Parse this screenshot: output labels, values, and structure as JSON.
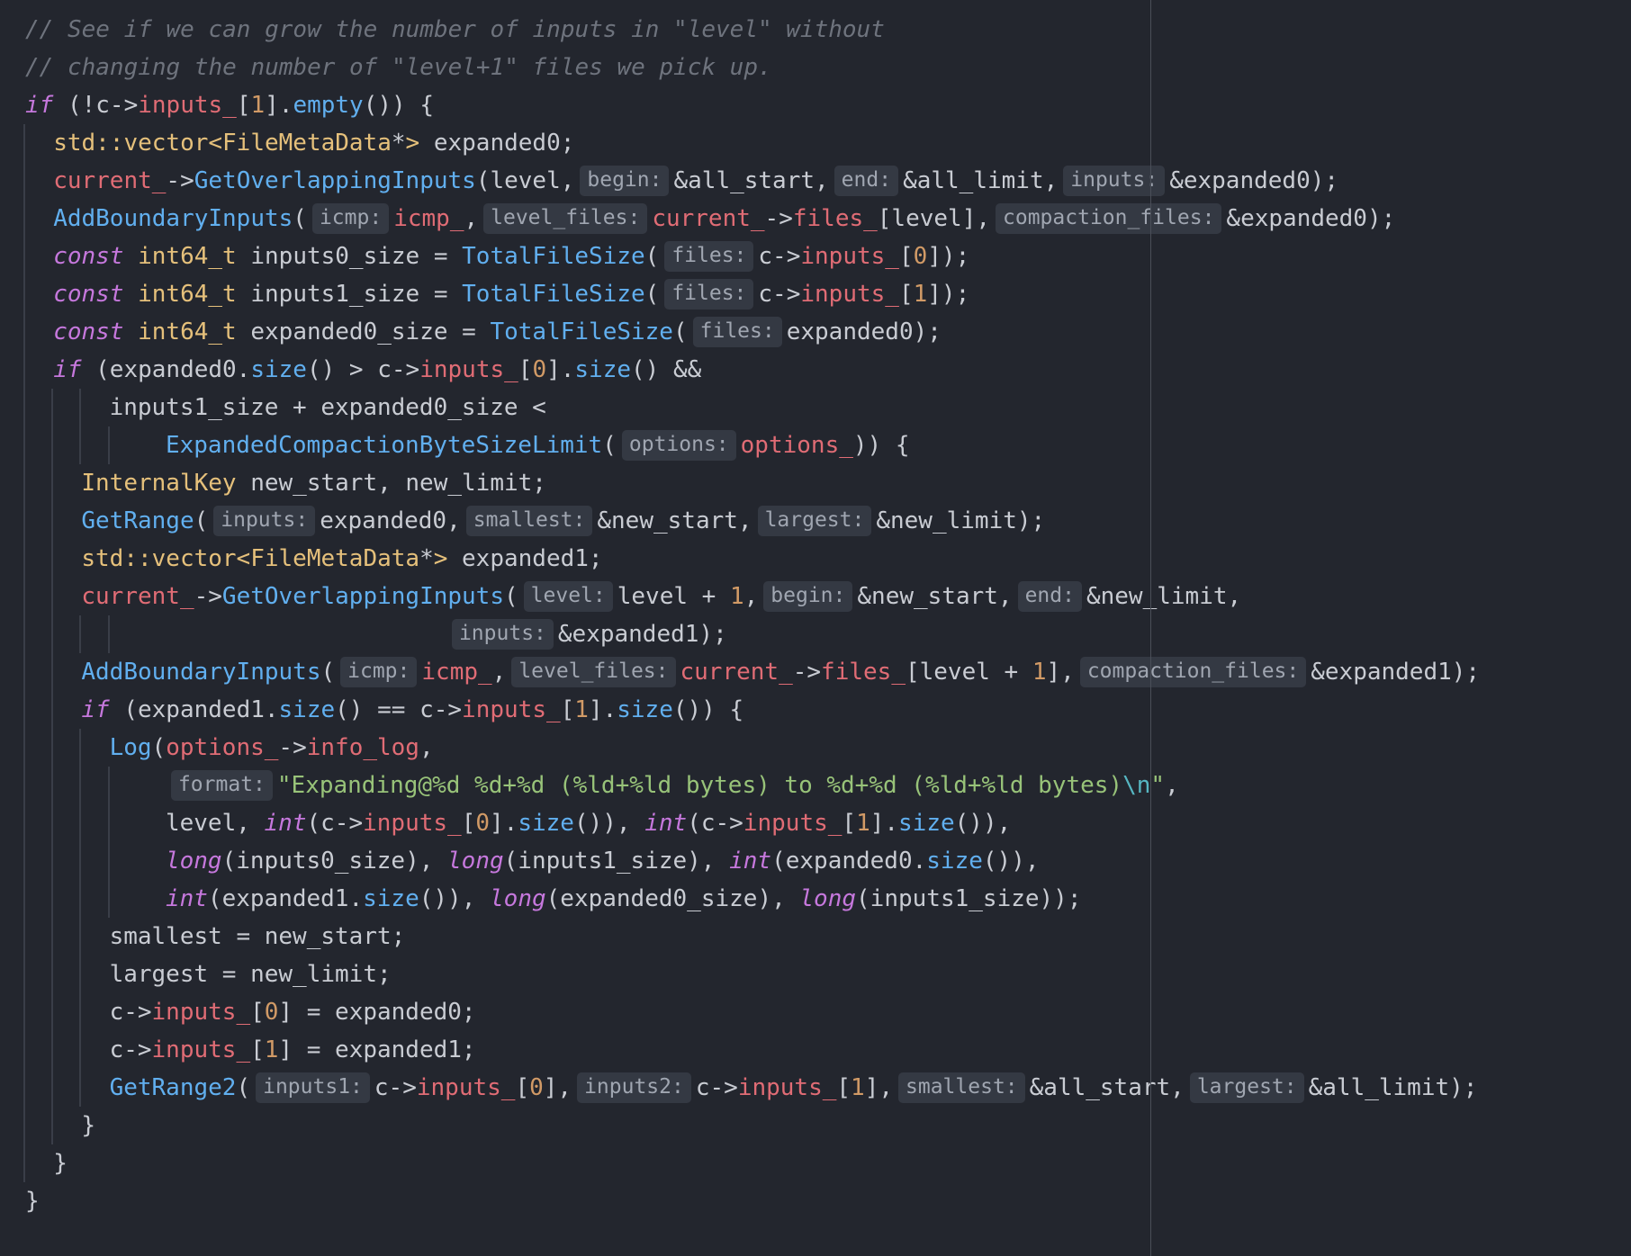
{
  "editor": {
    "language": "C++",
    "lines": [
      {
        "indent": 0,
        "guides": 0,
        "t": [
          {
            "c": "cm",
            "v": "// See if we can grow the number of inputs in \"level\" without"
          }
        ]
      },
      {
        "indent": 0,
        "guides": 0,
        "t": [
          {
            "c": "cm",
            "v": "// changing the number of \"level+1\" files we pick up."
          }
        ]
      },
      {
        "indent": 0,
        "guides": 0,
        "t": [
          {
            "c": "kw",
            "v": "if"
          },
          {
            "c": "",
            "v": " (!c->"
          },
          {
            "c": "fd",
            "v": "inputs_"
          },
          {
            "c": "",
            "v": "["
          },
          {
            "c": "nu",
            "v": "1"
          },
          {
            "c": "",
            "v": "]."
          },
          {
            "c": "fn",
            "v": "empty"
          },
          {
            "c": "",
            "v": "()) {"
          }
        ]
      },
      {
        "indent": 2,
        "guides": 1,
        "t": [
          {
            "c": "ty",
            "v": "std::vector<FileMetaData"
          },
          {
            "c": "",
            "v": "*"
          },
          {
            "c": "ty",
            "v": ">"
          },
          {
            "c": "",
            "v": " expanded0;"
          }
        ]
      },
      {
        "indent": 2,
        "guides": 1,
        "t": [
          {
            "c": "fd",
            "v": "current_"
          },
          {
            "c": "",
            "v": "->"
          },
          {
            "c": "fn",
            "v": "GetOverlappingInputs"
          },
          {
            "c": "",
            "v": "(level,"
          },
          {
            "c": "hint",
            "v": "begin:"
          },
          {
            "c": "",
            "v": "&all_start,"
          },
          {
            "c": "hint",
            "v": "end:"
          },
          {
            "c": "",
            "v": "&all_limit,"
          },
          {
            "c": "hint",
            "v": "inputs:"
          },
          {
            "c": "",
            "v": "&expanded0);"
          }
        ]
      },
      {
        "indent": 2,
        "guides": 1,
        "t": [
          {
            "c": "fn",
            "v": "AddBoundaryInputs"
          },
          {
            "c": "",
            "v": "("
          },
          {
            "c": "hint",
            "v": "icmp:"
          },
          {
            "c": "fd",
            "v": "icmp_"
          },
          {
            "c": "",
            "v": ","
          },
          {
            "c": "hint",
            "v": "level_files:"
          },
          {
            "c": "fd",
            "v": "current_"
          },
          {
            "c": "",
            "v": "->"
          },
          {
            "c": "fd",
            "v": "files_"
          },
          {
            "c": "",
            "v": "[level],"
          },
          {
            "c": "hint",
            "v": "compaction_files:"
          },
          {
            "c": "",
            "v": "&expanded0);"
          }
        ]
      },
      {
        "indent": 2,
        "guides": 1,
        "t": [
          {
            "c": "kw",
            "v": "const"
          },
          {
            "c": "",
            "v": " "
          },
          {
            "c": "ty",
            "v": "int64_t"
          },
          {
            "c": "",
            "v": " inputs0_size = "
          },
          {
            "c": "fn",
            "v": "TotalFileSize"
          },
          {
            "c": "",
            "v": "("
          },
          {
            "c": "hint",
            "v": "files:"
          },
          {
            "c": "",
            "v": "c->"
          },
          {
            "c": "fd",
            "v": "inputs_"
          },
          {
            "c": "",
            "v": "["
          },
          {
            "c": "nu",
            "v": "0"
          },
          {
            "c": "",
            "v": "]);"
          }
        ]
      },
      {
        "indent": 2,
        "guides": 1,
        "t": [
          {
            "c": "kw",
            "v": "const"
          },
          {
            "c": "",
            "v": " "
          },
          {
            "c": "ty",
            "v": "int64_t"
          },
          {
            "c": "",
            "v": " inputs1_size = "
          },
          {
            "c": "fn",
            "v": "TotalFileSize"
          },
          {
            "c": "",
            "v": "("
          },
          {
            "c": "hint",
            "v": "files:"
          },
          {
            "c": "",
            "v": "c->"
          },
          {
            "c": "fd",
            "v": "inputs_"
          },
          {
            "c": "",
            "v": "["
          },
          {
            "c": "nu",
            "v": "1"
          },
          {
            "c": "",
            "v": "]);"
          }
        ]
      },
      {
        "indent": 2,
        "guides": 1,
        "t": [
          {
            "c": "kw",
            "v": "const"
          },
          {
            "c": "",
            "v": " "
          },
          {
            "c": "ty",
            "v": "int64_t"
          },
          {
            "c": "",
            "v": " expanded0_size = "
          },
          {
            "c": "fn",
            "v": "TotalFileSize"
          },
          {
            "c": "",
            "v": "("
          },
          {
            "c": "hint",
            "v": "files:"
          },
          {
            "c": "",
            "v": "expanded0);"
          }
        ]
      },
      {
        "indent": 2,
        "guides": 1,
        "t": [
          {
            "c": "kw",
            "v": "if"
          },
          {
            "c": "",
            "v": " (expanded0."
          },
          {
            "c": "fn",
            "v": "size"
          },
          {
            "c": "",
            "v": "() > c->"
          },
          {
            "c": "fd",
            "v": "inputs_"
          },
          {
            "c": "",
            "v": "["
          },
          {
            "c": "nu",
            "v": "0"
          },
          {
            "c": "",
            "v": "]."
          },
          {
            "c": "fn",
            "v": "size"
          },
          {
            "c": "",
            "v": "() &&"
          }
        ]
      },
      {
        "indent": 6,
        "guides": 2,
        "t": [
          {
            "c": "",
            "v": "inputs1_size + expanded0_size <"
          }
        ]
      },
      {
        "indent": 10,
        "guides": 3,
        "t": [
          {
            "c": "fn",
            "v": "ExpandedCompactionByteSizeLimit"
          },
          {
            "c": "",
            "v": "("
          },
          {
            "c": "hint",
            "v": "options:"
          },
          {
            "c": "fd",
            "v": "options_"
          },
          {
            "c": "",
            "v": ")) {"
          }
        ]
      },
      {
        "indent": 4,
        "guides": 2,
        "t": [
          {
            "c": "ty",
            "v": "InternalKey"
          },
          {
            "c": "",
            "v": " new_start, new_limit;"
          }
        ]
      },
      {
        "indent": 4,
        "guides": 2,
        "t": [
          {
            "c": "fn",
            "v": "GetRange"
          },
          {
            "c": "",
            "v": "("
          },
          {
            "c": "hint",
            "v": "inputs:"
          },
          {
            "c": "",
            "v": "expanded0,"
          },
          {
            "c": "hint",
            "v": "smallest:"
          },
          {
            "c": "",
            "v": "&new_start,"
          },
          {
            "c": "hint",
            "v": "largest:"
          },
          {
            "c": "",
            "v": "&new_limit);"
          }
        ]
      },
      {
        "indent": 4,
        "guides": 2,
        "t": [
          {
            "c": "ty",
            "v": "std::vector<FileMetaData"
          },
          {
            "c": "",
            "v": "*"
          },
          {
            "c": "ty",
            "v": ">"
          },
          {
            "c": "",
            "v": " expanded1;"
          }
        ]
      },
      {
        "indent": 4,
        "guides": 2,
        "t": [
          {
            "c": "fd",
            "v": "current_"
          },
          {
            "c": "",
            "v": "->"
          },
          {
            "c": "fn",
            "v": "GetOverlappingInputs"
          },
          {
            "c": "",
            "v": "("
          },
          {
            "c": "hint",
            "v": "level:"
          },
          {
            "c": "",
            "v": "level + "
          },
          {
            "c": "nu",
            "v": "1"
          },
          {
            "c": "",
            "v": ","
          },
          {
            "c": "hint",
            "v": "begin:"
          },
          {
            "c": "",
            "v": "&new_start,"
          },
          {
            "c": "hint",
            "v": "end:"
          },
          {
            "c": "",
            "v": "&new_limit,"
          }
        ]
      },
      {
        "indent": 30,
        "guides": 3,
        "t": [
          {
            "c": "hint",
            "v": "inputs:"
          },
          {
            "c": "",
            "v": "&expanded1);"
          }
        ]
      },
      {
        "indent": 4,
        "guides": 2,
        "t": [
          {
            "c": "fn",
            "v": "AddBoundaryInputs"
          },
          {
            "c": "",
            "v": "("
          },
          {
            "c": "hint",
            "v": "icmp:"
          },
          {
            "c": "fd",
            "v": "icmp_"
          },
          {
            "c": "",
            "v": ","
          },
          {
            "c": "hint",
            "v": "level_files:"
          },
          {
            "c": "fd",
            "v": "current_"
          },
          {
            "c": "",
            "v": "->"
          },
          {
            "c": "fd",
            "v": "files_"
          },
          {
            "c": "",
            "v": "[level + "
          },
          {
            "c": "nu",
            "v": "1"
          },
          {
            "c": "",
            "v": "],"
          },
          {
            "c": "hint",
            "v": "compaction_files:"
          },
          {
            "c": "",
            "v": "&expanded1);"
          }
        ]
      },
      {
        "indent": 4,
        "guides": 2,
        "t": [
          {
            "c": "kw",
            "v": "if"
          },
          {
            "c": "",
            "v": " (expanded1."
          },
          {
            "c": "fn",
            "v": "size"
          },
          {
            "c": "",
            "v": "() == c->"
          },
          {
            "c": "fd",
            "v": "inputs_"
          },
          {
            "c": "",
            "v": "["
          },
          {
            "c": "nu",
            "v": "1"
          },
          {
            "c": "",
            "v": "]."
          },
          {
            "c": "fn",
            "v": "size"
          },
          {
            "c": "",
            "v": "()) {"
          }
        ]
      },
      {
        "indent": 6,
        "guides": 3,
        "t": [
          {
            "c": "fn",
            "v": "Log"
          },
          {
            "c": "",
            "v": "("
          },
          {
            "c": "fd",
            "v": "options_"
          },
          {
            "c": "",
            "v": "->"
          },
          {
            "c": "fd",
            "v": "info_log"
          },
          {
            "c": "",
            "v": ","
          }
        ]
      },
      {
        "indent": 10,
        "guides": 4,
        "t": [
          {
            "c": "hint",
            "v": "format:"
          },
          {
            "c": "st",
            "v": "\"Expanding@%d %d+%d (%ld+%ld bytes) to %d+%d (%ld+%ld bytes)"
          },
          {
            "c": "es",
            "v": "\\n"
          },
          {
            "c": "st",
            "v": "\""
          },
          {
            "c": "",
            "v": ","
          }
        ]
      },
      {
        "indent": 10,
        "guides": 4,
        "t": [
          {
            "c": "",
            "v": "level, "
          },
          {
            "c": "kw",
            "v": "int"
          },
          {
            "c": "",
            "v": "(c->"
          },
          {
            "c": "fd",
            "v": "inputs_"
          },
          {
            "c": "",
            "v": "["
          },
          {
            "c": "nu",
            "v": "0"
          },
          {
            "c": "",
            "v": "]."
          },
          {
            "c": "fn",
            "v": "size"
          },
          {
            "c": "",
            "v": "()), "
          },
          {
            "c": "kw",
            "v": "int"
          },
          {
            "c": "",
            "v": "(c->"
          },
          {
            "c": "fd",
            "v": "inputs_"
          },
          {
            "c": "",
            "v": "["
          },
          {
            "c": "nu",
            "v": "1"
          },
          {
            "c": "",
            "v": "]."
          },
          {
            "c": "fn",
            "v": "size"
          },
          {
            "c": "",
            "v": "()),"
          }
        ]
      },
      {
        "indent": 10,
        "guides": 4,
        "t": [
          {
            "c": "kw",
            "v": "long"
          },
          {
            "c": "",
            "v": "(inputs0_size), "
          },
          {
            "c": "kw",
            "v": "long"
          },
          {
            "c": "",
            "v": "(inputs1_size), "
          },
          {
            "c": "kw",
            "v": "int"
          },
          {
            "c": "",
            "v": "(expanded0."
          },
          {
            "c": "fn",
            "v": "size"
          },
          {
            "c": "",
            "v": "()),"
          }
        ]
      },
      {
        "indent": 10,
        "guides": 4,
        "t": [
          {
            "c": "kw",
            "v": "int"
          },
          {
            "c": "",
            "v": "(expanded1."
          },
          {
            "c": "fn",
            "v": "size"
          },
          {
            "c": "",
            "v": "()), "
          },
          {
            "c": "kw",
            "v": "long"
          },
          {
            "c": "",
            "v": "(expanded0_size), "
          },
          {
            "c": "kw",
            "v": "long"
          },
          {
            "c": "",
            "v": "(inputs1_size));"
          }
        ]
      },
      {
        "indent": 6,
        "guides": 3,
        "t": [
          {
            "c": "",
            "v": "smallest = new_start;"
          }
        ]
      },
      {
        "indent": 6,
        "guides": 3,
        "t": [
          {
            "c": "",
            "v": "largest = new_limit;"
          }
        ]
      },
      {
        "indent": 6,
        "guides": 3,
        "t": [
          {
            "c": "",
            "v": "c->"
          },
          {
            "c": "fd",
            "v": "inputs_"
          },
          {
            "c": "",
            "v": "["
          },
          {
            "c": "nu",
            "v": "0"
          },
          {
            "c": "",
            "v": "] = expanded0;"
          }
        ]
      },
      {
        "indent": 6,
        "guides": 3,
        "t": [
          {
            "c": "",
            "v": "c->"
          },
          {
            "c": "fd",
            "v": "inputs_"
          },
          {
            "c": "",
            "v": "["
          },
          {
            "c": "nu",
            "v": "1"
          },
          {
            "c": "",
            "v": "] = expanded1;"
          }
        ]
      },
      {
        "indent": 6,
        "guides": 3,
        "t": [
          {
            "c": "fn",
            "v": "GetRange2"
          },
          {
            "c": "",
            "v": "("
          },
          {
            "c": "hint",
            "v": "inputs1:"
          },
          {
            "c": "",
            "v": "c->"
          },
          {
            "c": "fd",
            "v": "inputs_"
          },
          {
            "c": "",
            "v": "["
          },
          {
            "c": "nu",
            "v": "0"
          },
          {
            "c": "",
            "v": "],"
          },
          {
            "c": "hint",
            "v": "inputs2:"
          },
          {
            "c": "",
            "v": "c->"
          },
          {
            "c": "fd",
            "v": "inputs_"
          },
          {
            "c": "",
            "v": "["
          },
          {
            "c": "nu",
            "v": "1"
          },
          {
            "c": "",
            "v": "],"
          },
          {
            "c": "hint",
            "v": "smallest:"
          },
          {
            "c": "",
            "v": "&all_start,"
          },
          {
            "c": "hint",
            "v": "largest:"
          },
          {
            "c": "",
            "v": "&all_limit);"
          }
        ]
      },
      {
        "indent": 4,
        "guides": 2,
        "t": [
          {
            "c": "",
            "v": "}"
          }
        ]
      },
      {
        "indent": 2,
        "guides": 1,
        "t": [
          {
            "c": "",
            "v": "}"
          }
        ]
      },
      {
        "indent": 0,
        "guides": 0,
        "t": [
          {
            "c": "",
            "v": "}"
          }
        ]
      }
    ]
  }
}
